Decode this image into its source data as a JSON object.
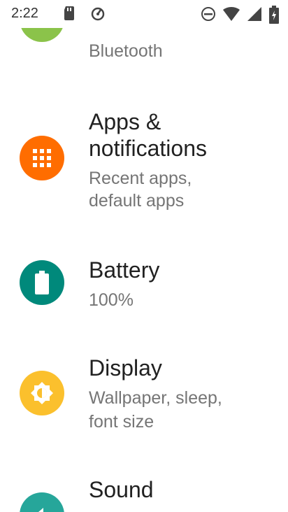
{
  "status_bar": {
    "time": "2:22",
    "icons": [
      "sd-card-icon",
      "sync-icon",
      "do-not-disturb-icon",
      "wifi-icon",
      "signal-icon",
      "battery-icon"
    ]
  },
  "settings": [
    {
      "title": "",
      "subtitle": "Bluetooth",
      "icon": "connected-devices-icon",
      "color": "#8BC34A"
    },
    {
      "title_line1": "Apps &",
      "title_line2": "notifications",
      "subtitle_line1": "Recent apps,",
      "subtitle_line2": "default apps",
      "icon": "apps-grid-icon",
      "color": "#FF6D00"
    },
    {
      "title": "Battery",
      "subtitle": "100%",
      "icon": "battery-icon",
      "color": "#00897B"
    },
    {
      "title": "Display",
      "subtitle_line1": "Wallpaper, sleep,",
      "subtitle_line2": "font size",
      "icon": "brightness-icon",
      "color": "#FBC02D"
    },
    {
      "title": "Sound",
      "icon": "volume-icon",
      "color": "#26A69A"
    }
  ]
}
